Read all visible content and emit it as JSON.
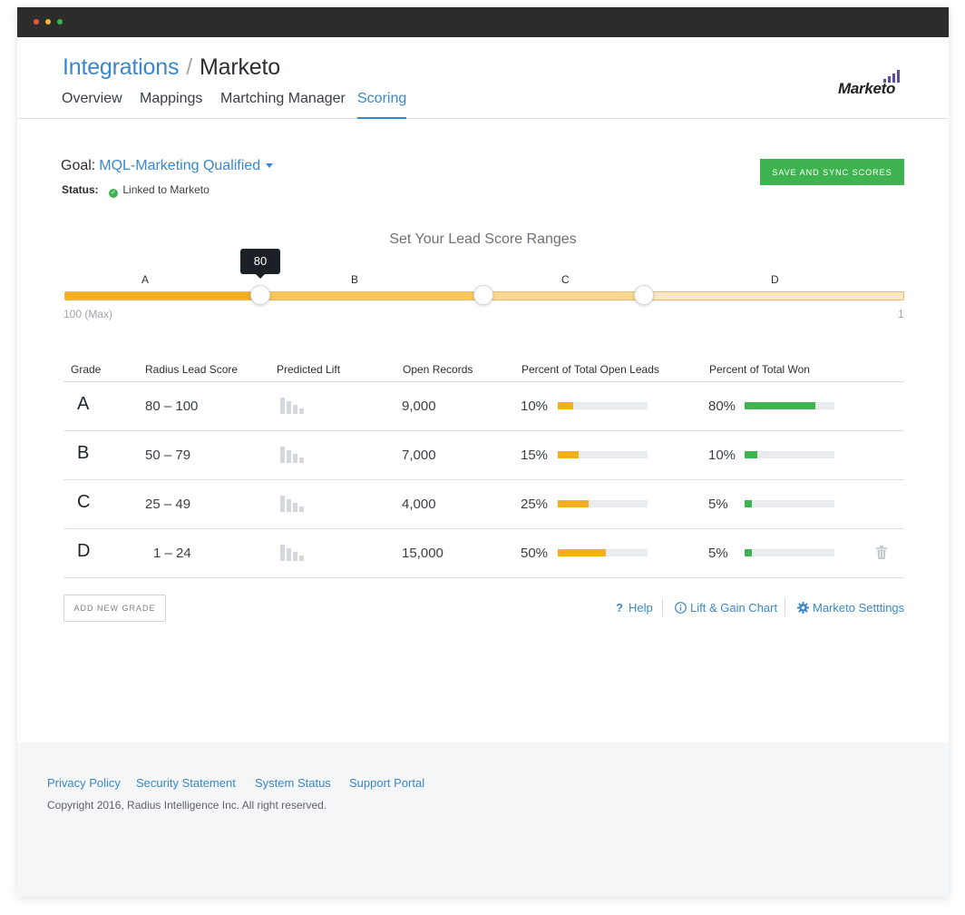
{
  "window": {
    "controls": {
      "close_color": "#f2543d",
      "minimize_color": "#f5b730",
      "maximize_color": "#3fb34f"
    }
  },
  "header": {
    "breadcrumb_parent": "Integrations",
    "breadcrumb_separator": "/",
    "breadcrumb_current": "Marketo",
    "tabs": [
      {
        "label": "Overview",
        "active": false
      },
      {
        "label": "Mappings",
        "active": false
      },
      {
        "label": "Martching Manager",
        "active": false
      },
      {
        "label": "Scoring",
        "active": true
      }
    ],
    "brand_logo": "Marketo"
  },
  "goal": {
    "label": "Goal:",
    "value": "MQL-Marketing Qualified",
    "status_label": "Status:",
    "status_text": "Linked to Marketo",
    "status_color": "#3fb34f"
  },
  "actions": {
    "save_label": "Save and sync scores",
    "add_grade_label": "Add new grade"
  },
  "range": {
    "title": "Set Your Lead Score Ranges",
    "grades": [
      "A",
      "B",
      "C",
      "D"
    ],
    "tooltip_value": "80",
    "min_label": "100 (Max)",
    "max_label": "1",
    "colors": [
      "#f4ae1e",
      "#f8c65a",
      "#fbd892",
      "#fce8c4"
    ]
  },
  "table": {
    "columns": [
      "Grade",
      "Radius Lead Score",
      "Predicted Lift",
      "Open Records",
      "Percent of Total Open Leads",
      "Percent of Total Won"
    ],
    "rows": [
      {
        "grade": "A",
        "score": "80 – 100",
        "records": "9,000",
        "open_pct": "10%",
        "open_fill": 0.17,
        "won_pct": "80%",
        "won_fill": 0.79
      },
      {
        "grade": "B",
        "score": "50 – 79",
        "records": "7,000",
        "open_pct": "15%",
        "open_fill": 0.23,
        "won_pct": "10%",
        "won_fill": 0.14
      },
      {
        "grade": "C",
        "score": "25 – 49",
        "records": "4,000",
        "open_pct": "25%",
        "open_fill": 0.34,
        "won_pct": "5%",
        "won_fill": 0.08
      },
      {
        "grade": "D",
        "score": "1 – 24",
        "records": "15,000",
        "open_pct": "50%",
        "open_fill": 0.54,
        "won_pct": "5%",
        "won_fill": 0.08
      }
    ],
    "open_color": "#f4ae1e",
    "won_color": "#3fb34f"
  },
  "links": {
    "help": "Help",
    "chart": "Lift & Gain Chart",
    "settings": "Marketo Setttings"
  },
  "footer": {
    "links": [
      "Privacy Policy",
      "Security Statement",
      "System Status",
      "Support Portal"
    ],
    "copyright": "Copyright 2016, Radius Intelligence Inc. All right reserved."
  }
}
